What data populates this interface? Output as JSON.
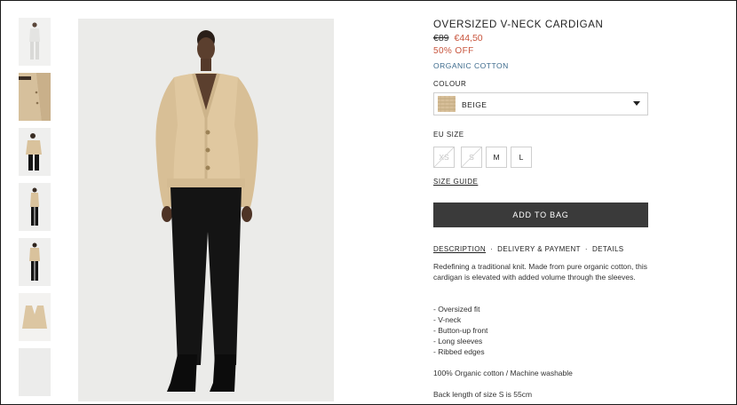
{
  "thumbnails": [
    {
      "name": "thumb-1",
      "selected": false
    },
    {
      "name": "thumb-2",
      "selected": false
    },
    {
      "name": "thumb-3",
      "selected": false
    },
    {
      "name": "thumb-4",
      "selected": false
    },
    {
      "name": "thumb-5",
      "selected": false
    },
    {
      "name": "thumb-6",
      "selected": false
    },
    {
      "name": "thumb-7",
      "selected": false
    }
  ],
  "product": {
    "title": "OVERSIZED V-NECK CARDIGAN",
    "price_old": "€89",
    "price_new": "€44,50",
    "discount": "50% OFF",
    "material": "ORGANIC COTTON"
  },
  "colour": {
    "label": "COLOUR",
    "value": "BEIGE",
    "swatch_color": "#d8c09a"
  },
  "size": {
    "label": "EU SIZE",
    "options": [
      {
        "label": "XS",
        "available": false
      },
      {
        "label": "S",
        "available": false
      },
      {
        "label": "M",
        "available": true
      },
      {
        "label": "L",
        "available": true
      }
    ],
    "guide_label": "SIZE GUIDE"
  },
  "add_to_bag": "ADD TO BAG",
  "tabs": [
    "DESCRIPTION",
    "DELIVERY & PAYMENT",
    "DETAILS"
  ],
  "description": {
    "intro": "Redefining a traditional knit. Made from pure organic cotton, this cardigan is elevated with added volume through the sleeves.",
    "bullets": [
      "- Oversized fit",
      "- V-neck",
      "- Button-up front",
      "- Long sleeves",
      "- Ribbed edges"
    ],
    "care": "100% Organic cotton / Machine washable",
    "length": "Back length of size S is 55cm"
  },
  "colors": {
    "accent_sale": "#c8553d",
    "material_link": "#3c6a8c",
    "button_bg": "#3a3a3a"
  }
}
